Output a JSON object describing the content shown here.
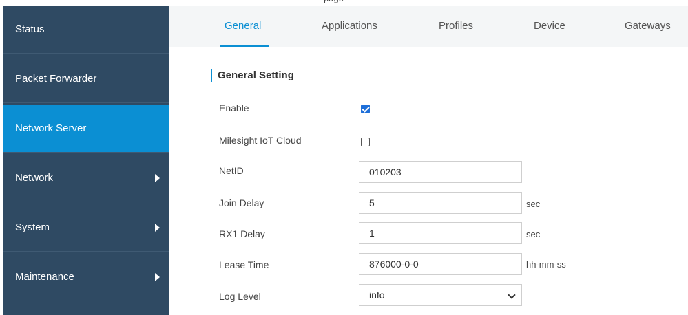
{
  "top_cut_text": "page",
  "sidebar": {
    "items": [
      {
        "label": "Status"
      },
      {
        "label": "Packet Forwarder"
      },
      {
        "label": "Network Server"
      },
      {
        "label": "Network"
      },
      {
        "label": "System"
      },
      {
        "label": "Maintenance"
      }
    ]
  },
  "tabs": [
    {
      "label": "General"
    },
    {
      "label": "Applications"
    },
    {
      "label": "Profiles"
    },
    {
      "label": "Device"
    },
    {
      "label": "Gateways"
    }
  ],
  "section": {
    "title": "General Setting"
  },
  "form": {
    "enable": {
      "label": "Enable",
      "checked": true
    },
    "cloud": {
      "label": "Milesight IoT Cloud",
      "checked": false
    },
    "netid": {
      "label": "NetID",
      "value": "010203"
    },
    "join_delay": {
      "label": "Join Delay",
      "value": "5",
      "unit": "sec"
    },
    "rx1_delay": {
      "label": "RX1 Delay",
      "value": "1",
      "unit": "sec"
    },
    "lease_time": {
      "label": "Lease Time",
      "value": "876000-0-0",
      "unit": "hh-mm-ss"
    },
    "log_level": {
      "label": "Log Level",
      "value": "info"
    }
  },
  "colors": {
    "sidebar_bg": "#2f4a63",
    "accent": "#0b8fd3",
    "checkbox_checked": "#1e6fd9"
  }
}
